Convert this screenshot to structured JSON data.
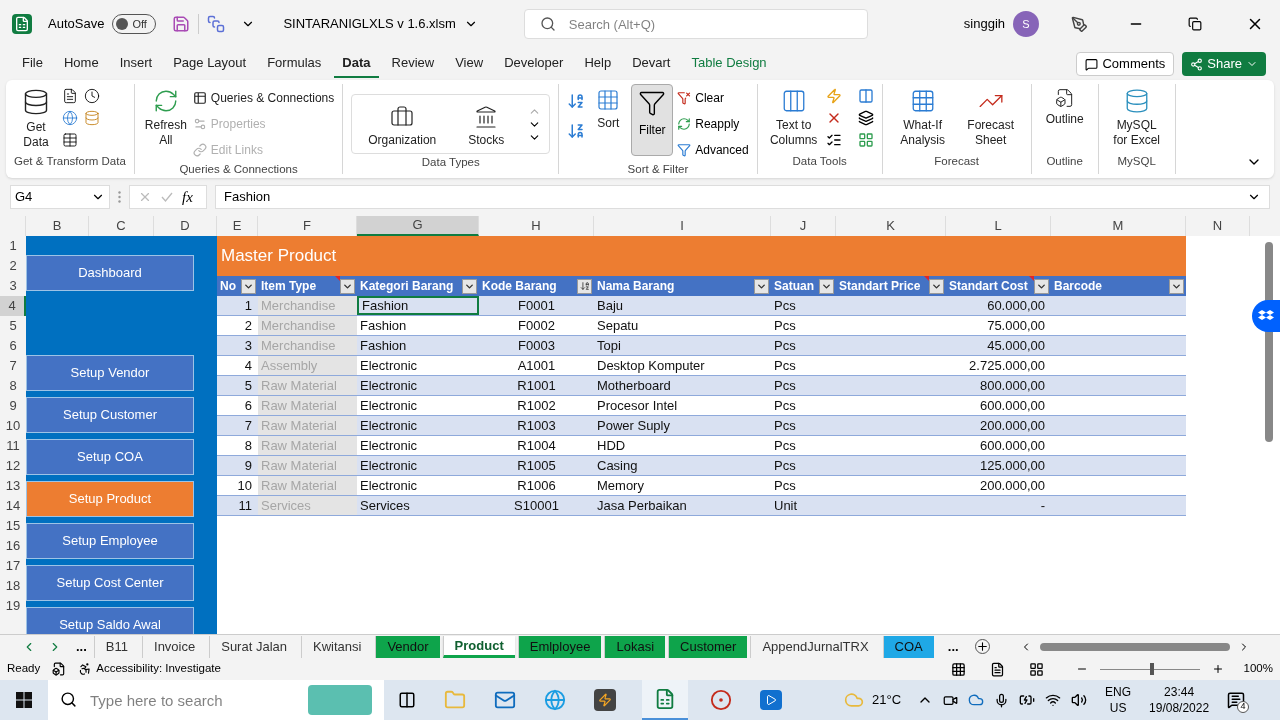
{
  "title_bar": {
    "autosave_label": "AutoSave",
    "autosave": {
      "on": false,
      "label": "Off"
    },
    "filename": "SINTARANIGLXLS v 1.6.xlsm",
    "search": {
      "placeholder": "Search (Alt+Q)"
    },
    "user": "singgih",
    "avatar": "S"
  },
  "menu_tabs": [
    {
      "label": "File",
      "selected": false,
      "kind": "normal"
    },
    {
      "label": "Home",
      "selected": false,
      "kind": "normal"
    },
    {
      "label": "Insert",
      "selected": false,
      "kind": "normal"
    },
    {
      "label": "Page Layout",
      "selected": false,
      "kind": "normal"
    },
    {
      "label": "Formulas",
      "selected": false,
      "kind": "normal"
    },
    {
      "label": "Data",
      "selected": true,
      "kind": "normal"
    },
    {
      "label": "Review",
      "selected": false,
      "kind": "normal"
    },
    {
      "label": "View",
      "selected": false,
      "kind": "normal"
    },
    {
      "label": "Developer",
      "selected": false,
      "kind": "normal"
    },
    {
      "label": "Help",
      "selected": false,
      "kind": "normal"
    },
    {
      "label": "Devart",
      "selected": false,
      "kind": "normal"
    },
    {
      "label": "Table Design",
      "selected": false,
      "kind": "contextual"
    }
  ],
  "header_buttons": {
    "comments": "Comments",
    "share": "Share"
  },
  "ribbon": {
    "get_transform": {
      "label": "Get & Transform Data",
      "get_data": "Get Data"
    },
    "queries": {
      "label": "Queries & Connections",
      "refresh_all": "Refresh All",
      "items": [
        {
          "label": "Queries & Connections",
          "disabled": false
        },
        {
          "label": "Properties",
          "disabled": true
        },
        {
          "label": "Edit Links",
          "disabled": true
        }
      ]
    },
    "data_types": {
      "label": "Data Types",
      "items": [
        "Organization",
        "Stocks"
      ]
    },
    "sort_filter": {
      "label": "Sort & Filter",
      "sort": "Sort",
      "filter": {
        "label": "Filter",
        "on": true
      },
      "items": [
        "Clear",
        "Reapply",
        "Advanced"
      ]
    },
    "data_tools": {
      "label": "Data Tools",
      "text_to_columns": "Text to Columns"
    },
    "forecast": {
      "label": "Forecast",
      "items": [
        "What-If Analysis",
        "Forecast Sheet"
      ]
    },
    "outline": {
      "label": "Outline",
      "button": "Outline"
    },
    "mysql": {
      "label": "MySQL",
      "button": "MySQL for Excel"
    }
  },
  "formula_bar": {
    "name_box": "G4",
    "function_label": "fx",
    "value": "Fashion"
  },
  "column_headers": [
    {
      "label": "B",
      "selected": false
    },
    {
      "label": "C",
      "selected": false
    },
    {
      "label": "D",
      "selected": false
    },
    {
      "label": "E",
      "selected": false
    },
    {
      "label": "F",
      "selected": false
    },
    {
      "label": "G",
      "selected": true
    },
    {
      "label": "H",
      "selected": false
    },
    {
      "label": "I",
      "selected": false
    },
    {
      "label": "J",
      "selected": false
    },
    {
      "label": "K",
      "selected": false
    },
    {
      "label": "L",
      "selected": false
    },
    {
      "label": "M",
      "selected": false
    },
    {
      "label": "N",
      "selected": false
    }
  ],
  "row_headers": [
    {
      "label": "1",
      "selected": false
    },
    {
      "label": "2",
      "selected": false
    },
    {
      "label": "3",
      "selected": false
    },
    {
      "label": "4",
      "selected": true
    },
    {
      "label": "5",
      "selected": false
    },
    {
      "label": "6",
      "selected": false
    },
    {
      "label": "7",
      "selected": false
    },
    {
      "label": "8",
      "selected": false
    },
    {
      "label": "9",
      "selected": false
    },
    {
      "label": "10",
      "selected": false
    },
    {
      "label": "11",
      "selected": false
    },
    {
      "label": "12",
      "selected": false
    },
    {
      "label": "13",
      "selected": false
    },
    {
      "label": "14",
      "selected": false
    },
    {
      "label": "15",
      "selected": false
    },
    {
      "label": "16",
      "selected": false
    },
    {
      "label": "17",
      "selected": false
    },
    {
      "label": "18",
      "selected": false
    },
    {
      "label": "19",
      "selected": false
    }
  ],
  "sidebar": [
    {
      "label": "Dashboard",
      "selected": false
    },
    {
      "label": "Setup Vendor",
      "selected": false
    },
    {
      "label": "Setup Customer",
      "selected": false
    },
    {
      "label": "Setup COA",
      "selected": false
    },
    {
      "label": "Setup Product",
      "selected": true
    },
    {
      "label": "Setup Employee",
      "selected": false
    },
    {
      "label": "Setup Cost Center",
      "selected": false
    },
    {
      "label": "Setup Saldo Awal",
      "selected": false
    }
  ],
  "table": {
    "title": "Master Product",
    "columns": [
      {
        "label": "No",
        "kind": "number",
        "sorted": false,
        "comment": false
      },
      {
        "label": "Item Type",
        "kind": "muted",
        "sorted": false,
        "comment": true
      },
      {
        "label": "Kategori Barang",
        "kind": "text",
        "sorted": false,
        "comment": false
      },
      {
        "label": "Kode Barang",
        "kind": "code",
        "sorted": true,
        "comment": false
      },
      {
        "label": "Nama Barang",
        "kind": "text",
        "sorted": false,
        "comment": false
      },
      {
        "label": "Satuan",
        "kind": "text",
        "sorted": false,
        "comment": false
      },
      {
        "label": "Standart Price",
        "kind": "number",
        "sorted": false,
        "comment": true
      },
      {
        "label": "Standart Cost",
        "kind": "number",
        "sorted": false,
        "comment": true
      },
      {
        "label": "Barcode",
        "kind": "text",
        "sorted": false,
        "comment": false
      }
    ],
    "rows": [
      {
        "no": "1",
        "item_type": "Merchandise",
        "kategori": "Fashion",
        "kode": "F0001",
        "nama": "Baju",
        "satuan": "Pcs",
        "standart_cost": "60.000,00",
        "selected": true
      },
      {
        "no": "2",
        "item_type": "Merchandise",
        "kategori": "Fashion",
        "kode": "F0002",
        "nama": "Sepatu",
        "satuan": "Pcs",
        "standart_cost": "75.000,00",
        "selected": false
      },
      {
        "no": "3",
        "item_type": "Merchandise",
        "kategori": "Fashion",
        "kode": "F0003",
        "nama": "Topi",
        "satuan": "Pcs",
        "standart_cost": "45.000,00",
        "selected": false
      },
      {
        "no": "4",
        "item_type": "Assembly",
        "kategori": "Electronic",
        "kode": "A1001",
        "nama": "Desktop Komputer",
        "satuan": "Pcs",
        "standart_cost": "2.725.000,00",
        "selected": false
      },
      {
        "no": "5",
        "item_type": "Raw Material",
        "kategori": "Electronic",
        "kode": "R1001",
        "nama": "Motherboard",
        "satuan": "Pcs",
        "standart_cost": "800.000,00",
        "selected": false
      },
      {
        "no": "6",
        "item_type": "Raw Material",
        "kategori": "Electronic",
        "kode": "R1002",
        "nama": "Procesor Intel",
        "satuan": "Pcs",
        "standart_cost": "600.000,00",
        "selected": false
      },
      {
        "no": "7",
        "item_type": "Raw Material",
        "kategori": "Electronic",
        "kode": "R1003",
        "nama": "Power Suply",
        "satuan": "Pcs",
        "standart_cost": "200.000,00",
        "selected": false
      },
      {
        "no": "8",
        "item_type": "Raw Material",
        "kategori": "Electronic",
        "kode": "R1004",
        "nama": "HDD",
        "satuan": "Pcs",
        "standart_cost": "600.000,00",
        "selected": false
      },
      {
        "no": "9",
        "item_type": "Raw Material",
        "kategori": "Electronic",
        "kode": "R1005",
        "nama": "Casing",
        "satuan": "Pcs",
        "standart_cost": "125.000,00",
        "selected": false
      },
      {
        "no": "10",
        "item_type": "Raw Material",
        "kategori": "Electronic",
        "kode": "R1006",
        "nama": "Memory",
        "satuan": "Pcs",
        "standart_cost": "200.000,00",
        "selected": false
      },
      {
        "no": "11",
        "item_type": "Services",
        "kategori": "Services",
        "kode": "S10001",
        "nama": "Jasa Perbaikan",
        "satuan": "Unit",
        "standart_cost": "-",
        "selected": false
      }
    ]
  },
  "sheet_nav": {
    "more_left": "...",
    "more_right": "..."
  },
  "sheet_tabs": [
    {
      "label": "B11",
      "selected": false
    },
    {
      "label": "Invoice",
      "selected": false
    },
    {
      "label": "Surat Jalan",
      "selected": false
    },
    {
      "label": "Kwitansi",
      "selected": false
    },
    {
      "label": "Vendor",
      "selected": false,
      "color": "#0ea44b"
    },
    {
      "label": "Product",
      "selected": true,
      "color": "#0ea44b"
    },
    {
      "label": "Emlployee",
      "selected": false,
      "color": "#0ea44b"
    },
    {
      "label": "Lokasi",
      "selected": false,
      "color": "#0ea44b"
    },
    {
      "label": "Customer",
      "selected": false,
      "color": "#0ea44b"
    },
    {
      "label": "AppendJurnalTRX",
      "selected": false
    },
    {
      "label": "COA",
      "selected": false,
      "color": "#1fa8e6"
    }
  ],
  "status_bar": {
    "ready": "Ready",
    "accessibility": "Accessibility: Investigate",
    "zoom": {
      "level": 0.52,
      "label": "100%"
    }
  },
  "taskbar": {
    "search": {
      "placeholder": "Type here to search"
    },
    "weather": "21°C",
    "language": [
      "ENG",
      "US"
    ],
    "time": "23:44",
    "date": "19/08/2022",
    "notifications": "4"
  }
}
